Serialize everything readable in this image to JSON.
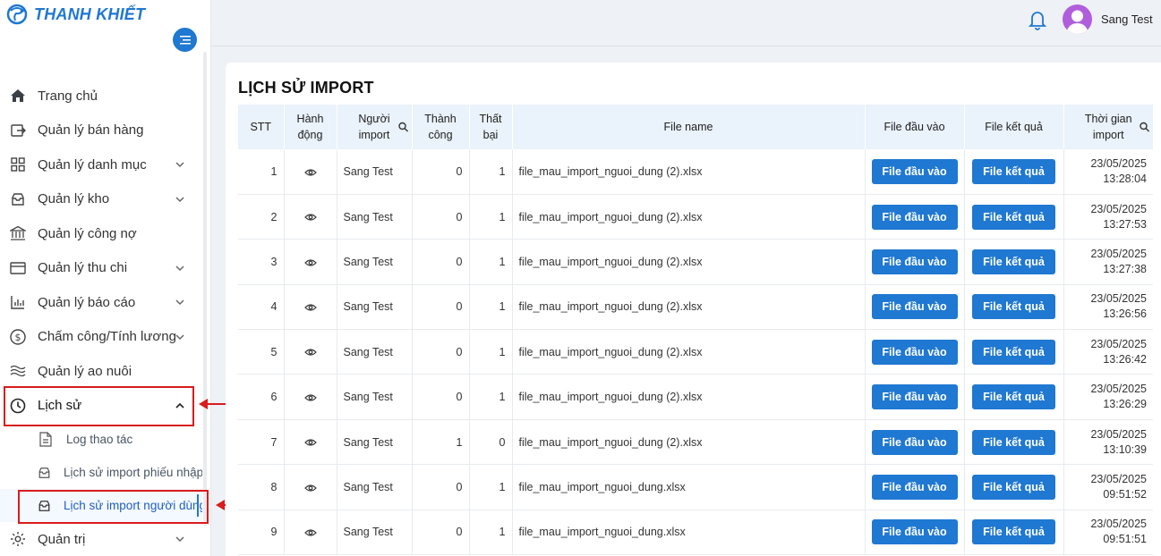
{
  "brand": {
    "name": "THANH KHIẾT"
  },
  "sidebar": {
    "items": [
      {
        "label": "Trang chủ",
        "icon": "home-icon",
        "chevron": false
      },
      {
        "label": "Quản lý bán hàng",
        "icon": "sales-icon",
        "chevron": false
      },
      {
        "label": "Quản lý danh mục",
        "icon": "grid-icon",
        "chevron": true
      },
      {
        "label": "Quản lý kho",
        "icon": "inbox-icon",
        "chevron": true
      },
      {
        "label": "Quản lý công nợ",
        "icon": "bank-icon",
        "chevron": false
      },
      {
        "label": "Quản lý thu chi",
        "icon": "card-icon",
        "chevron": true
      },
      {
        "label": "Quản lý báo cáo",
        "icon": "bar-chart-icon",
        "chevron": true
      },
      {
        "label": "Chấm công/Tính lương",
        "icon": "dollar-icon",
        "chevron": true
      },
      {
        "label": "Quản lý ao nuôi",
        "icon": "waves-icon",
        "chevron": false
      },
      {
        "label": "Lịch sử",
        "icon": "clock-icon",
        "chevron": true,
        "expanded": true
      }
    ],
    "subitems": [
      {
        "label": "Log thao tác",
        "icon": "file-icon"
      },
      {
        "label": "Lịch sử import phiếu nhập",
        "icon": "inbox-icon"
      },
      {
        "label": "Lịch sử import người dùng",
        "icon": "inbox-icon",
        "current": true
      }
    ],
    "last_item": {
      "label": "Quản trị",
      "icon": "gear-icon"
    }
  },
  "header": {
    "user_name": "Sang Test"
  },
  "page": {
    "title": "LỊCH SỬ IMPORT",
    "columns": {
      "stt": "STT",
      "action_l1": "Hành",
      "action_l2": "động",
      "user_l1": "Người",
      "user_l2": "import",
      "success_l1": "Thành",
      "success_l2": "công",
      "fail_l1": "Thất",
      "fail_l2": "bại",
      "file_name": "File name",
      "input_file": "File đầu vào",
      "result_file": "File kết quả",
      "time_l1": "Thời gian",
      "time_l2": "import"
    },
    "button_labels": {
      "input": "File đầu vào",
      "result": "File kết quả"
    },
    "rows": [
      {
        "stt": "1",
        "user": "Sang Test",
        "success": "0",
        "fail": "1",
        "file": "file_mau_import_nguoi_dung (2).xlsx",
        "date": "23/05/2025",
        "time": "13:28:04"
      },
      {
        "stt": "2",
        "user": "Sang Test",
        "success": "0",
        "fail": "1",
        "file": "file_mau_import_nguoi_dung (2).xlsx",
        "date": "23/05/2025",
        "time": "13:27:53"
      },
      {
        "stt": "3",
        "user": "Sang Test",
        "success": "0",
        "fail": "1",
        "file": "file_mau_import_nguoi_dung (2).xlsx",
        "date": "23/05/2025",
        "time": "13:27:38"
      },
      {
        "stt": "4",
        "user": "Sang Test",
        "success": "0",
        "fail": "1",
        "file": "file_mau_import_nguoi_dung (2).xlsx",
        "date": "23/05/2025",
        "time": "13:26:56"
      },
      {
        "stt": "5",
        "user": "Sang Test",
        "success": "0",
        "fail": "1",
        "file": "file_mau_import_nguoi_dung (2).xlsx",
        "date": "23/05/2025",
        "time": "13:26:42"
      },
      {
        "stt": "6",
        "user": "Sang Test",
        "success": "0",
        "fail": "1",
        "file": "file_mau_import_nguoi_dung (2).xlsx",
        "date": "23/05/2025",
        "time": "13:26:29"
      },
      {
        "stt": "7",
        "user": "Sang Test",
        "success": "1",
        "fail": "0",
        "file": "file_mau_import_nguoi_dung (2).xlsx",
        "date": "23/05/2025",
        "time": "13:10:39"
      },
      {
        "stt": "8",
        "user": "Sang Test",
        "success": "0",
        "fail": "1",
        "file": "file_mau_import_nguoi_dung.xlsx",
        "date": "23/05/2025",
        "time": "09:51:52"
      },
      {
        "stt": "9",
        "user": "Sang Test",
        "success": "0",
        "fail": "1",
        "file": "file_mau_import_nguoi_dung.xlsx",
        "date": "23/05/2025",
        "time": "09:51:51"
      }
    ]
  },
  "colors": {
    "accent": "#1f78d1",
    "highlight": "#d91c1c",
    "avatar": "#b05fdc"
  }
}
